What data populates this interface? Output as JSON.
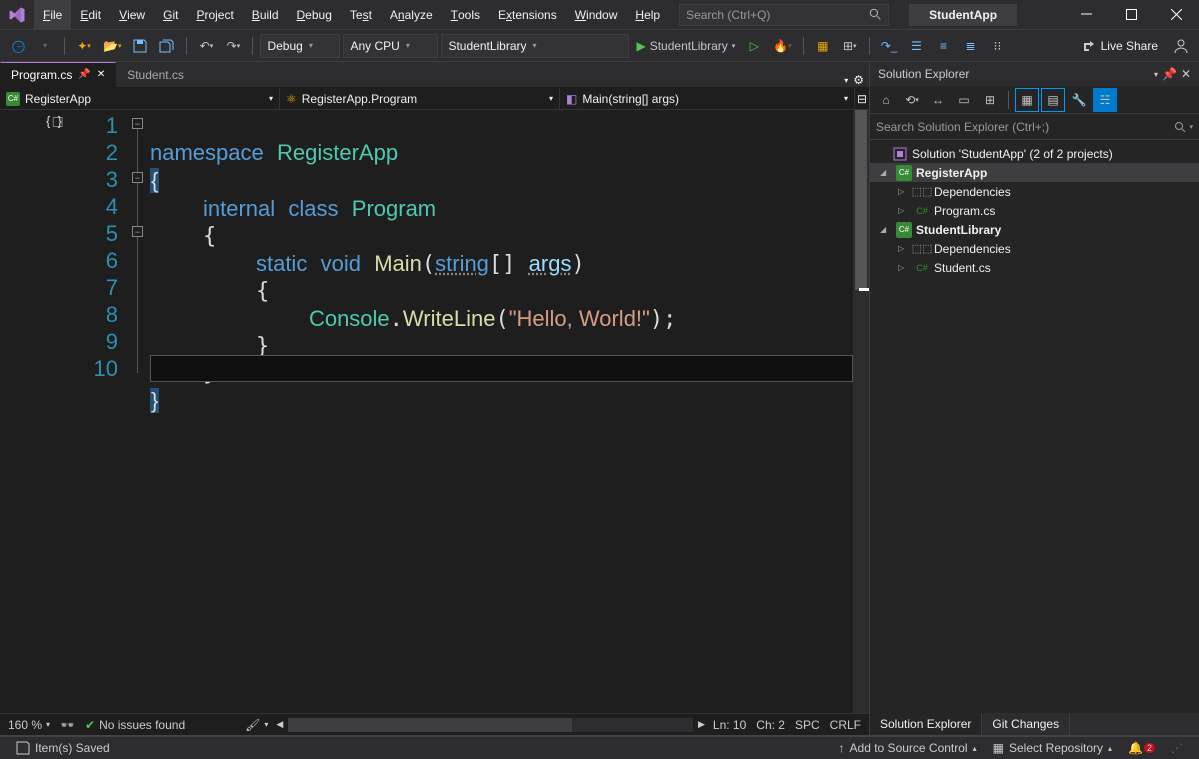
{
  "menu": {
    "file": "File",
    "edit": "Edit",
    "view": "View",
    "git": "Git",
    "project": "Project",
    "build": "Build",
    "debug": "Debug",
    "test": "Test",
    "analyze": "Analyze",
    "tools": "Tools",
    "extensions": "Extensions",
    "window": "Window",
    "help": "Help"
  },
  "search_placeholder": "Search (Ctrl+Q)",
  "app_name": "StudentApp",
  "toolbar": {
    "config": "Debug",
    "platform": "Any CPU",
    "startup": "StudentLibrary",
    "run_target": "StudentLibrary",
    "live_share": "Live Share"
  },
  "tabs": [
    {
      "label": "Program.cs",
      "pinned": true,
      "active": true
    },
    {
      "label": "Student.cs",
      "active": false
    }
  ],
  "nav": {
    "proj": "RegisterApp",
    "class": "RegisterApp.Program",
    "method": "Main(string[] args)"
  },
  "code_lines": [
    "1",
    "2",
    "3",
    "4",
    "5",
    "6",
    "7",
    "8",
    "9",
    "10"
  ],
  "bottom": {
    "zoom": "160 %",
    "issues": "No issues found",
    "ln": "Ln: 10",
    "ch": "Ch: 2",
    "enc": "SPC",
    "eol": "CRLF"
  },
  "solution_explorer": {
    "title": "Solution Explorer",
    "search_placeholder": "Search Solution Explorer (Ctrl+;)",
    "root": "Solution 'StudentApp' (2 of 2 projects)",
    "proj1": "RegisterApp",
    "proj1_dep": "Dependencies",
    "proj1_file": "Program.cs",
    "proj2": "StudentLibrary",
    "proj2_dep": "Dependencies",
    "proj2_file": "Student.cs",
    "tab1": "Solution Explorer",
    "tab2": "Git Changes"
  },
  "status": {
    "saved": "Item(s) Saved",
    "source_control": "Add to Source Control",
    "repo": "Select Repository",
    "notif_count": "2"
  },
  "code_tokens": {
    "namespace": "namespace",
    "RegisterApp": "RegisterApp",
    "internal": "internal",
    "class": "class",
    "Program": "Program",
    "static": "static",
    "void": "void",
    "Main": "Main",
    "string": "string",
    "args": "args",
    "Console": "Console",
    "WriteLine": "WriteLine",
    "msg": "\"Hello, World!\""
  }
}
